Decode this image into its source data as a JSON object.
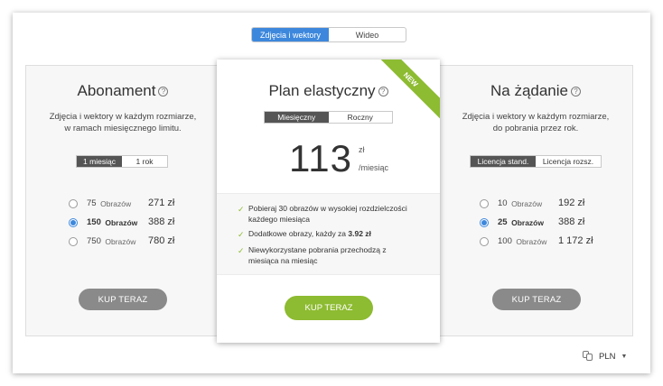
{
  "top_toggle": {
    "images_vectors": "Zdjęcia i wektory",
    "video": "Wideo"
  },
  "subscription": {
    "title": "Abonament",
    "desc_line1": "Zdjęcia i wektory w każdym rozmiarze,",
    "desc_line2": "w ramach miesięcznego limitu.",
    "period_month": "1 miesiąc",
    "period_year": "1 rok",
    "options": [
      {
        "count": "75",
        "unit": "Obrazów",
        "price": "271 zł"
      },
      {
        "count": "150",
        "unit": "Obrazów",
        "price": "388 zł"
      },
      {
        "count": "750",
        "unit": "Obrazów",
        "price": "780 zł"
      }
    ],
    "buy": "KUP TERAZ"
  },
  "flexible": {
    "title": "Plan elastyczny",
    "ribbon": "NEW",
    "period_monthly": "Miesięczny",
    "period_yearly": "Roczny",
    "price": "113",
    "currency": "zł",
    "per": "/miesiąc",
    "f1_line1": "Pobieraj 30 obrazów w wysokiej rozdzielczości",
    "f1_line2": "każdego miesiąca",
    "f2_text": "Dodatkowe obrazy, każdy za ",
    "f2_bold": "3.92 zł",
    "f3_line1": "Niewykorzystane pobrania przechodzą z",
    "f3_line2": "miesiąca na miesiąc",
    "buy": "KUP TERAZ"
  },
  "ondemand": {
    "title": "Na żądanie",
    "desc_line1": "Zdjęcia i wektory w każdym rozmiarze,",
    "desc_line2": "do pobrania przez rok.",
    "license_std": "Licencja stand.",
    "license_ext": "Licencja rozsz.",
    "options": [
      {
        "count": "10",
        "unit": "Obrazów",
        "price": "192 zł"
      },
      {
        "count": "25",
        "unit": "Obrazów",
        "price": "388 zł"
      },
      {
        "count": "100",
        "unit": "Obrazów",
        "price": "1 172 zł"
      }
    ],
    "buy": "KUP TERAZ"
  },
  "currency": {
    "code": "PLN"
  },
  "colors": {
    "accent_blue": "#3d88dd",
    "accent_green": "#8dbb31",
    "button_gray": "#8a8a8a"
  }
}
